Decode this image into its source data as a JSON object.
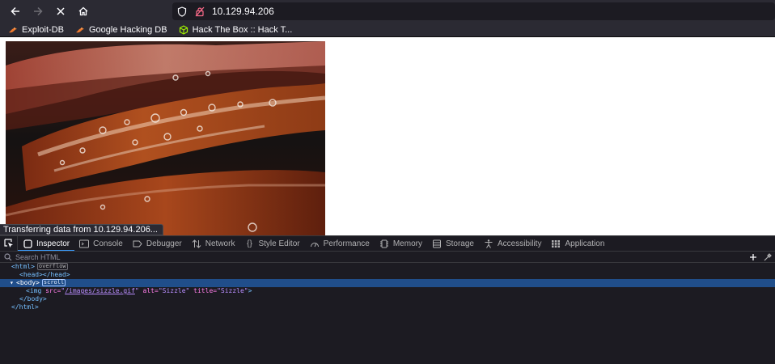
{
  "browser": {
    "url": "10.129.94.206",
    "bookmarks": [
      {
        "label": "Exploit-DB",
        "icon": "exploit-db-icon"
      },
      {
        "label": "Google Hacking DB",
        "icon": "ghdb-icon"
      },
      {
        "label": "Hack The Box :: Hack T...",
        "icon": "htb-icon"
      }
    ],
    "status": "Transferring data from 10.129.94.206..."
  },
  "devtools": {
    "tabs": [
      {
        "label": "Inspector",
        "icon": "inspector-icon",
        "active": true
      },
      {
        "label": "Console",
        "icon": "console-icon"
      },
      {
        "label": "Debugger",
        "icon": "debugger-icon"
      },
      {
        "label": "Network",
        "icon": "network-icon"
      },
      {
        "label": "Style Editor",
        "icon": "style-editor-icon"
      },
      {
        "label": "Performance",
        "icon": "performance-icon"
      },
      {
        "label": "Memory",
        "icon": "memory-icon"
      },
      {
        "label": "Storage",
        "icon": "storage-icon"
      },
      {
        "label": "Accessibility",
        "icon": "accessibility-icon"
      },
      {
        "label": "Application",
        "icon": "application-icon"
      }
    ],
    "search_placeholder": "Search HTML",
    "markup": {
      "html_open": "<html>",
      "overflow_badge": "overflow",
      "head": "<head></head>",
      "body_open": "<body>",
      "scroll_badge": "scroll",
      "img_tag_open": "<img",
      "img_src_attr": "src=",
      "img_src_val": "/images/sizzle.gif",
      "img_alt_attr": "alt=",
      "img_alt_val": "\"Sizzle\"",
      "img_title_attr": "title=",
      "img_title_val": "\"Sizzle\"",
      "img_tag_close": ">",
      "body_close": "</body>",
      "html_close": "</html>"
    }
  },
  "colors": {
    "accent": "#3b9cff",
    "selection": "#204e8a"
  }
}
